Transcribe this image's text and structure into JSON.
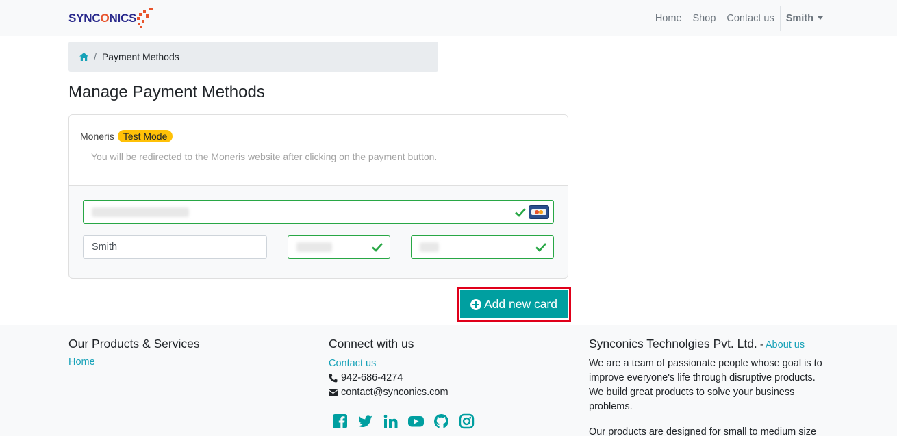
{
  "brand": {
    "name_start": "SYNC",
    "name_x": "O",
    "name_end": "NICS"
  },
  "nav": {
    "home": "Home",
    "shop": "Shop",
    "contact": "Contact us",
    "user": "Smith"
  },
  "breadcrumb": {
    "current": "Payment Methods"
  },
  "page": {
    "title": "Manage Payment Methods"
  },
  "payment": {
    "provider": "Moneris",
    "badge": "Test Mode",
    "note": "You will be redirected to the Moneris website after clicking on the payment button.",
    "cardholder_name": "Smith"
  },
  "actions": {
    "add_card": "Add new card"
  },
  "footer": {
    "products_title": "Our Products & Services",
    "products_link": "Home",
    "connect_title": "Connect with us",
    "contact_link": "Contact us",
    "phone": "942-686-4274",
    "email": "contact@synconics.com",
    "company_title": "Synconics Technolgies Pvt. Ltd.",
    "company_dash": " - ",
    "about_link": "About us",
    "about_p1": "We are a team of passionate people whose goal is to improve everyone's life through disruptive products. We build great products to solve your business problems.",
    "about_p2": "Our products are designed for small to medium size companies willing to optimize their performance."
  },
  "colors": {
    "accent": "#009fa0",
    "link": "#17a2b8",
    "badge": "#ffc107",
    "valid": "#28a745",
    "highlight": "#e0001a"
  }
}
